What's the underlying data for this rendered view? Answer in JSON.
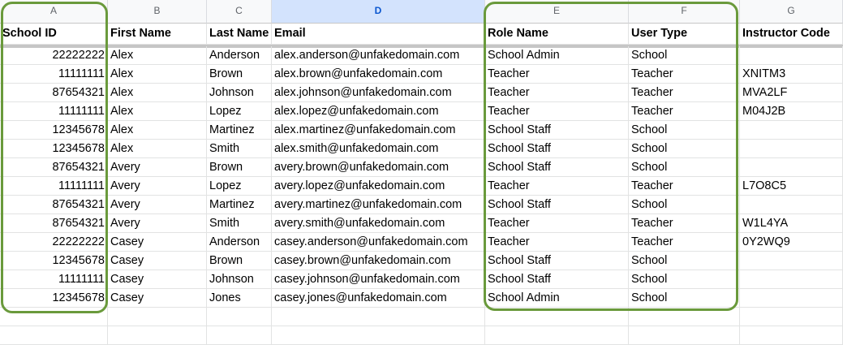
{
  "column_letters": [
    "A",
    "B",
    "C",
    "D",
    "E",
    "F",
    "G"
  ],
  "selected_column": "D",
  "headers": {
    "school_id": "School ID",
    "first_name": "First Name",
    "last_name": "Last Name",
    "email": "Email",
    "role_name": "Role Name",
    "user_type": "User Type",
    "instructor_code": "Instructor Code"
  },
  "rows": [
    {
      "school_id": "22222222",
      "first_name": "Alex",
      "last_name": "Anderson",
      "email": "alex.anderson@unfakedomain.com",
      "role_name": "School Admin",
      "user_type": "School",
      "instructor_code": ""
    },
    {
      "school_id": "11111111",
      "first_name": "Alex",
      "last_name": "Brown",
      "email": "alex.brown@unfakedomain.com",
      "role_name": "Teacher",
      "user_type": "Teacher",
      "instructor_code": "XNITM3"
    },
    {
      "school_id": "87654321",
      "first_name": "Alex",
      "last_name": "Johnson",
      "email": "alex.johnson@unfakedomain.com",
      "role_name": "Teacher",
      "user_type": "Teacher",
      "instructor_code": "MVA2LF"
    },
    {
      "school_id": "11111111",
      "first_name": "Alex",
      "last_name": "Lopez",
      "email": "alex.lopez@unfakedomain.com",
      "role_name": "Teacher",
      "user_type": "Teacher",
      "instructor_code": "M04J2B"
    },
    {
      "school_id": "12345678",
      "first_name": "Alex",
      "last_name": "Martinez",
      "email": "alex.martinez@unfakedomain.com",
      "role_name": "School Staff",
      "user_type": "School",
      "instructor_code": ""
    },
    {
      "school_id": "12345678",
      "first_name": "Alex",
      "last_name": "Smith",
      "email": "alex.smith@unfakedomain.com",
      "role_name": "School Staff",
      "user_type": "School",
      "instructor_code": ""
    },
    {
      "school_id": "87654321",
      "first_name": "Avery",
      "last_name": "Brown",
      "email": "avery.brown@unfakedomain.com",
      "role_name": "School Staff",
      "user_type": "School",
      "instructor_code": ""
    },
    {
      "school_id": "11111111",
      "first_name": "Avery",
      "last_name": "Lopez",
      "email": "avery.lopez@unfakedomain.com",
      "role_name": "Teacher",
      "user_type": "Teacher",
      "instructor_code": "L7O8C5"
    },
    {
      "school_id": "87654321",
      "first_name": "Avery",
      "last_name": "Martinez",
      "email": "avery.martinez@unfakedomain.com",
      "role_name": "School Staff",
      "user_type": "School",
      "instructor_code": ""
    },
    {
      "school_id": "87654321",
      "first_name": "Avery",
      "last_name": "Smith",
      "email": "avery.smith@unfakedomain.com",
      "role_name": "Teacher",
      "user_type": "Teacher",
      "instructor_code": "W1L4YA"
    },
    {
      "school_id": "22222222",
      "first_name": "Casey",
      "last_name": "Anderson",
      "email": "casey.anderson@unfakedomain.com",
      "role_name": "Teacher",
      "user_type": "Teacher",
      "instructor_code": "0Y2WQ9"
    },
    {
      "school_id": "12345678",
      "first_name": "Casey",
      "last_name": "Brown",
      "email": "casey.brown@unfakedomain.com",
      "role_name": "School Staff",
      "user_type": "School",
      "instructor_code": ""
    },
    {
      "school_id": "11111111",
      "first_name": "Casey",
      "last_name": "Johnson",
      "email": "casey.johnson@unfakedomain.com",
      "role_name": "School Staff",
      "user_type": "School",
      "instructor_code": ""
    },
    {
      "school_id": "12345678",
      "first_name": "Casey",
      "last_name": "Jones",
      "email": "casey.jones@unfakedomain.com",
      "role_name": "School Admin",
      "user_type": "School",
      "instructor_code": ""
    }
  ],
  "colors": {
    "highlight_outline": "#6a9a3c",
    "selected_header_bg": "#d3e3fd",
    "selected_header_text": "#0b57d0"
  }
}
